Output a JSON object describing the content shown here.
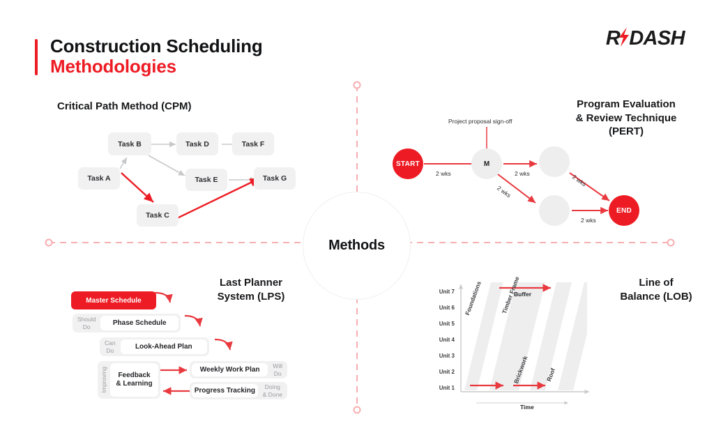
{
  "header": {
    "title_line1": "Construction Scheduling",
    "title_line2": "Methodologies",
    "accent_color": "#ED1C24",
    "logo": {
      "text": "R",
      "text2": "DASH",
      "bolt_icon": "lightning-bolt-icon"
    }
  },
  "hub": {
    "label": "Methods"
  },
  "sections": {
    "cpm": {
      "heading": "Critical Path Method (CPM)"
    },
    "pert": {
      "heading": "Program Evaluation\n& Review Technique\n(PERT)",
      "line1": "Program Evaluation",
      "line2": "& Review Technique",
      "line3": "(PERT)"
    },
    "lps": {
      "heading": "Last Planner\nSystem (LPS)",
      "line1": "Last Planner",
      "line2": "System (LPS)"
    },
    "lob": {
      "heading": "Line of\nBalance (LOB)",
      "line1": "Line of",
      "line2": "Balance (LOB)"
    }
  },
  "cpm": {
    "tasks": [
      {
        "id": "A",
        "label": "Task A"
      },
      {
        "id": "B",
        "label": "Task B"
      },
      {
        "id": "C",
        "label": "Task C"
      },
      {
        "id": "D",
        "label": "Task D"
      },
      {
        "id": "E",
        "label": "Task E"
      },
      {
        "id": "F",
        "label": "Task F"
      },
      {
        "id": "G",
        "label": "Task G"
      }
    ],
    "links": [
      {
        "from": "A",
        "to": "B",
        "critical": false
      },
      {
        "from": "A",
        "to": "C",
        "critical": true
      },
      {
        "from": "B",
        "to": "D",
        "critical": false
      },
      {
        "from": "B",
        "to": "E",
        "critical": false
      },
      {
        "from": "D",
        "to": "F",
        "critical": false
      },
      {
        "from": "E",
        "to": "G",
        "critical": false
      },
      {
        "from": "C",
        "to": "G",
        "critical": true
      }
    ],
    "critical_path_color": "#ED1C24",
    "normal_link_color": "#c7c8ca"
  },
  "pert": {
    "callout": "Project proposal sign-off",
    "nodes": [
      {
        "id": "start",
        "label": "START",
        "style": "red"
      },
      {
        "id": "m",
        "label": "M",
        "style": "grey"
      },
      {
        "id": "n1",
        "label": "",
        "style": "grey"
      },
      {
        "id": "n2",
        "label": "",
        "style": "grey"
      },
      {
        "id": "end",
        "label": "END",
        "style": "red"
      }
    ],
    "edges": [
      {
        "from": "start",
        "to": "m",
        "label": "2 wks"
      },
      {
        "from": "m",
        "to": "n1",
        "label": "2 wks"
      },
      {
        "from": "m",
        "to": "n2",
        "label": "2 wks"
      },
      {
        "from": "n1",
        "to": "end",
        "label": "2 wks"
      },
      {
        "from": "n2",
        "to": "end",
        "label": "2 wks"
      }
    ]
  },
  "lps": {
    "rows": [
      {
        "tag": "",
        "tag2": "",
        "card": "Master Schedule",
        "variant": "master"
      },
      {
        "tag": "Should",
        "tag2": "Do",
        "card": "Phase Schedule",
        "variant": "plain"
      },
      {
        "tag": "Can",
        "tag2": "Do",
        "card": "Look-Ahead Plan",
        "variant": "plain"
      },
      {
        "tag": "Will",
        "tag2": "Do",
        "card": "Weekly Work Plan",
        "variant": "right-tag"
      },
      {
        "tag": "Doing",
        "tag2": "& Done",
        "card": "Progress Tracking",
        "variant": "right-tag"
      }
    ],
    "feedback_card": "Feedback\n& Learning",
    "feedback_line1": "Feedback",
    "feedback_line2": "& Learning",
    "improving_tag": "Improving"
  },
  "lob": {
    "y_ticks": [
      "Unit 7",
      "Unit 6",
      "Unit 5",
      "Unit 4",
      "Unit 3",
      "Unit 2",
      "Unit 1"
    ],
    "x_label": "Time",
    "buffer_label": "Buffer",
    "bands": [
      "Foundations",
      "Timber Frame",
      "Brickwork",
      "Roof"
    ],
    "band_color": "#eeeeef"
  },
  "chart_data": {
    "type": "line",
    "title": "Line of Balance (LOB)",
    "xlabel": "Time",
    "ylabel": "Unit",
    "categories": [
      "Unit 1",
      "Unit 2",
      "Unit 3",
      "Unit 4",
      "Unit 5",
      "Unit 6",
      "Unit 7"
    ],
    "ylim": [
      1,
      7
    ],
    "grid": false,
    "legend": "none",
    "series": [
      {
        "name": "Foundations",
        "start_time": 0,
        "end_time": 32
      },
      {
        "name": "Timber Frame",
        "start_time": 18,
        "end_time": 52
      },
      {
        "name": "Brickwork",
        "start_time": 40,
        "end_time": 70
      },
      {
        "name": "Roof",
        "start_time": 58,
        "end_time": 88
      }
    ],
    "annotations": [
      {
        "label": "Buffer",
        "type": "arrow",
        "at": "Unit 7"
      },
      {
        "label": "",
        "type": "arrow",
        "at": "Unit 1"
      },
      {
        "label": "",
        "type": "arrow",
        "at": "Unit 1"
      }
    ]
  }
}
